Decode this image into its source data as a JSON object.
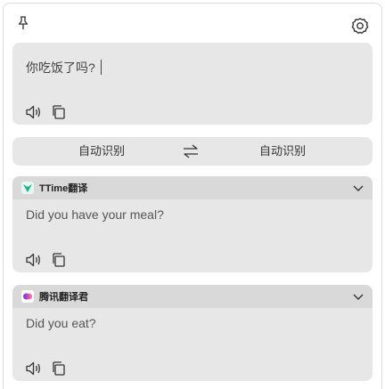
{
  "toolbar": {
    "pin_icon": "pin-icon",
    "settings_icon": "gear-icon"
  },
  "source": {
    "text": "你吃饭了吗?",
    "actions": [
      "speaker-icon",
      "copy-icon"
    ]
  },
  "languages": {
    "source_label": "自动识别",
    "target_label": "自动识别",
    "swap_icon": "swap-icon"
  },
  "results": [
    {
      "service": "TTime翻译",
      "text": "Did you have your meal?",
      "logo_color": "#1db38a"
    },
    {
      "service": "腾讯翻译君",
      "text": "Did you eat?",
      "logo_color": "#8b5cf6"
    }
  ]
}
